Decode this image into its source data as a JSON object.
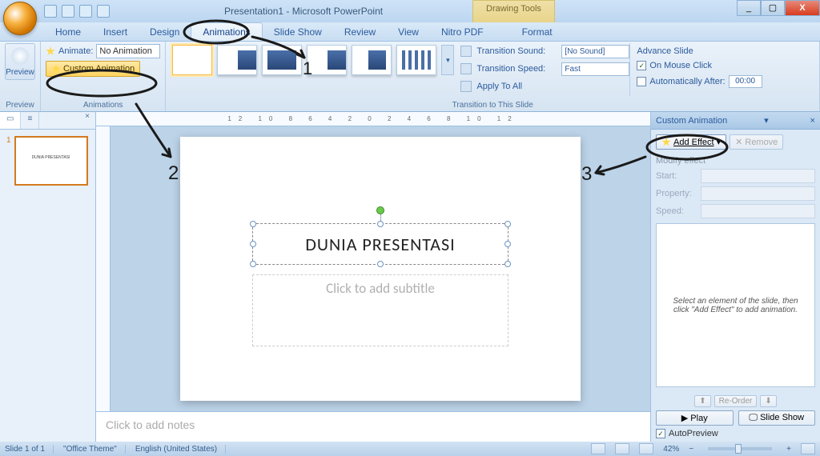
{
  "titlebar": {
    "doc_title": "Presentation1 - Microsoft PowerPoint",
    "contextual_tab_title": "Drawing Tools"
  },
  "ribbon_tabs": {
    "home": "Home",
    "insert": "Insert",
    "design": "Design",
    "animations": "Animations",
    "slideshow": "Slide Show",
    "review": "Review",
    "view": "View",
    "nitro": "Nitro PDF",
    "format": "Format"
  },
  "ribbon": {
    "preview_label": "Preview",
    "preview_group": "Preview",
    "animate_label": "Animate:",
    "animate_value": "No Animation",
    "custom_anim_btn": "Custom Animation",
    "animations_group": "Animations",
    "trans_sound_label": "Transition Sound:",
    "trans_sound_value": "[No Sound]",
    "trans_speed_label": "Transition Speed:",
    "trans_speed_value": "Fast",
    "apply_all": "Apply To All",
    "transition_group": "Transition to This Slide",
    "advance_title": "Advance Slide",
    "on_mouse_click": "On Mouse Click",
    "auto_after": "Automatically After:",
    "auto_after_value": "00:00"
  },
  "slidepanel": {
    "tab_slides": "Slides",
    "tab_outline": "Outline",
    "thumb1_text": "DUNIA PRESENTASI"
  },
  "canvas": {
    "title_text": "DUNIA PRESENTASI",
    "subtitle_placeholder": "Click to add subtitle"
  },
  "notes": {
    "placeholder": "Click to add notes"
  },
  "taskpane": {
    "title": "Custom Animation",
    "add_effect": "Add Effect",
    "remove": "Remove",
    "modify_title": "Modify effect",
    "start_label": "Start:",
    "property_label": "Property:",
    "speed_label": "Speed:",
    "list_hint": "Select an element of the slide, then click \"Add Effect\" to add animation.",
    "reorder": "Re-Order",
    "play": "Play",
    "slideshow": "Slide Show",
    "autopreview": "AutoPreview"
  },
  "statusbar": {
    "slide_of": "Slide 1 of 1",
    "theme": "\"Office Theme\"",
    "lang": "English (United States)",
    "zoom": "42%"
  },
  "ruler_text": "12  10  8  6  4  2  0  2  4  6  8  10  12"
}
